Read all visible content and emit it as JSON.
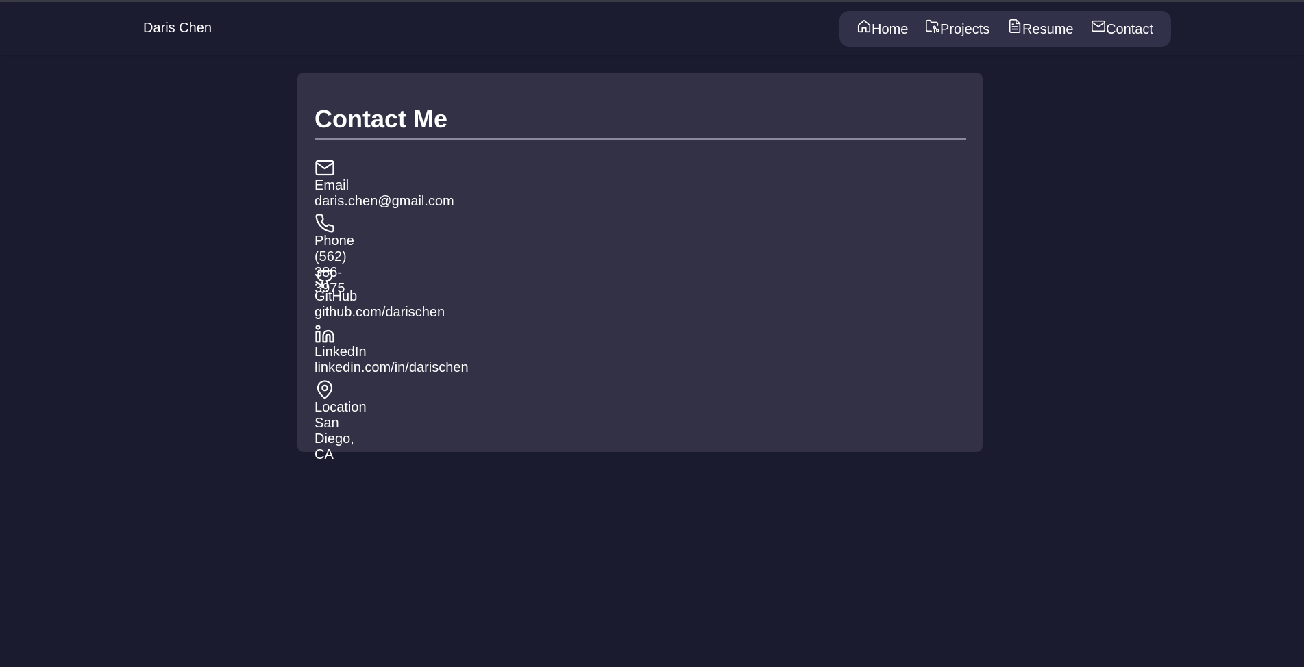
{
  "header": {
    "brand": "Daris Chen",
    "nav": [
      {
        "label": "Home",
        "icon": "home-icon"
      },
      {
        "label": "Projects",
        "icon": "folder-git-icon"
      },
      {
        "label": "Resume",
        "icon": "file-text-icon"
      },
      {
        "label": "Contact",
        "icon": "mail-icon"
      }
    ]
  },
  "main": {
    "title": "Contact Me",
    "contacts": [
      {
        "label": "Email",
        "value": "daris.chen@gmail.com",
        "icon": "mail-icon"
      },
      {
        "label": "Phone",
        "value": "(562) 386-3975",
        "icon": "phone-icon"
      },
      {
        "label": "GitHub",
        "value": "github.com/darischen",
        "icon": "github-icon"
      },
      {
        "label": "LinkedIn",
        "value": "linkedin.com/in/darischen",
        "icon": "linkedin-icon"
      },
      {
        "label": "Location",
        "value": "San Diego, CA",
        "icon": "map-pin-icon"
      }
    ]
  },
  "colors": {
    "background": "#1a1b2e",
    "card": "#323146",
    "nav_pill": "#31314a",
    "text": "#ffffff",
    "divider": "#8a8a9a"
  }
}
